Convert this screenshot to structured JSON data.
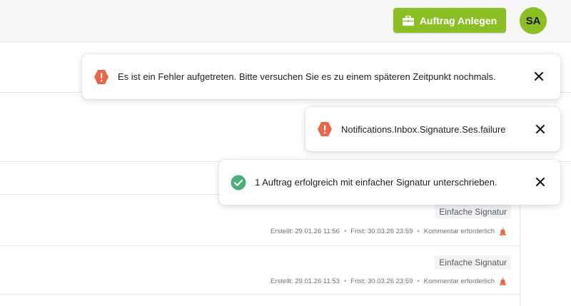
{
  "header": {
    "create_order_label": "Auftrag Anlegen",
    "create_order_icon": "briefcase-icon",
    "avatar_initials": "SA"
  },
  "colors": {
    "accent": "#8cbf26",
    "error": "#e8674a",
    "success": "#4caf7a"
  },
  "list": {
    "rows": [
      {
        "signature_type": "Einfache Signatur",
        "created": "Erstellt: 29.01.26 11:56",
        "deadline": "Frist: 30.03.26 23:59",
        "comment": "Kommentar erforderlich"
      },
      {
        "signature_type": "Einfache Signatur",
        "created": "Erstellt: 29.01.26 11:53",
        "deadline": "Frist: 30.03.26 23:59",
        "comment": "Kommentar erforderlich"
      }
    ]
  },
  "toasts": [
    {
      "type": "error",
      "icon": "error-hexagon-icon",
      "message": "Es ist ein Fehler aufgetreten. Bitte versuchen Sie es zu einem späteren Zeitpunkt nochmals."
    },
    {
      "type": "error",
      "icon": "error-hexagon-icon",
      "message": "Notifications.Inbox.Signature.Ses.failure"
    },
    {
      "type": "success",
      "icon": "check-circle-icon",
      "message": "1 Auftrag erfolgreich mit einfacher Signatur unterschrieben."
    }
  ]
}
